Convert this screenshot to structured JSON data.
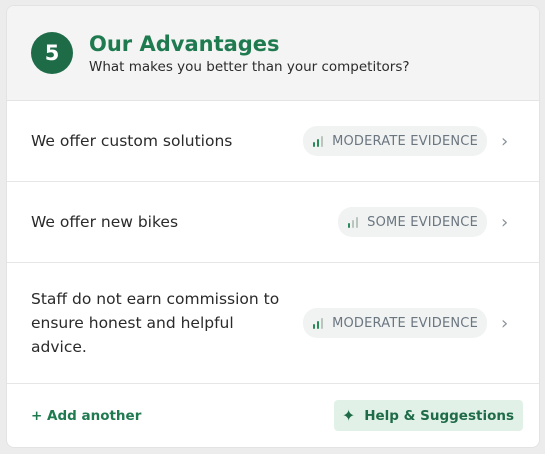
{
  "section": {
    "step_number": "5",
    "title": "Our Advantages",
    "subtitle": "What makes you better than your competitors?"
  },
  "advantages": [
    {
      "text": "We offer custom solutions",
      "evidence_label": "MODERATE EVIDENCE",
      "evidence_level": 2
    },
    {
      "text": "We offer new bikes",
      "evidence_label": "SOME EVIDENCE",
      "evidence_level": 1
    },
    {
      "text": "Staff do not earn commission to ensure honest and helpful advice.",
      "evidence_label": "MODERATE EVIDENCE",
      "evidence_level": 2
    }
  ],
  "footer": {
    "add_label": "+ Add another",
    "help_label": "Help & Suggestions"
  },
  "icons": {
    "evidence": "signal-bars-icon",
    "chevron": "chevron-right-icon",
    "help": "sparkle-icon"
  },
  "colors": {
    "accent": "#1f7a50",
    "badge_bg": "#1e6b48",
    "help_bg": "#e2f1e8"
  }
}
